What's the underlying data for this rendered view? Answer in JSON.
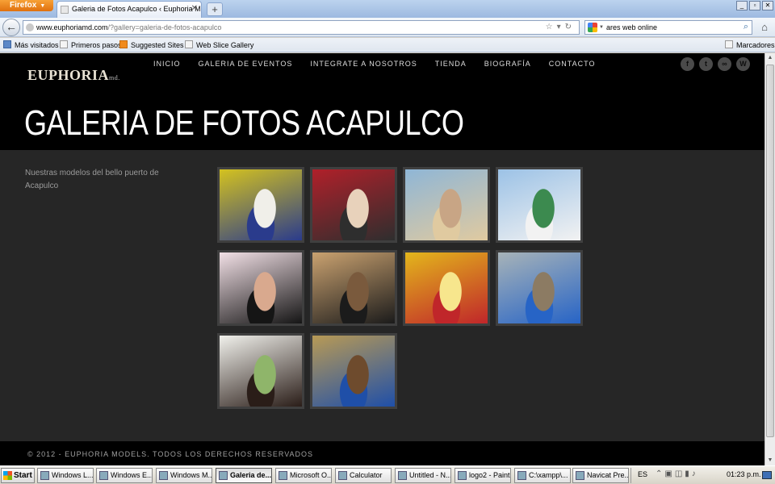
{
  "browser": {
    "app_button": "Firefox",
    "tab_title": "Galeria de Fotos Acapulco ‹ Euphoria Models",
    "new_tab": "+",
    "url_domain": "www.euphoriamd.com",
    "url_path": "/?gallery=galeria-de-fotos-acapulco",
    "search_value": "ares web online"
  },
  "bookmarks": [
    {
      "label": "Más visitados"
    },
    {
      "label": "Primeros pasos"
    },
    {
      "label": "Suggested Sites"
    },
    {
      "label": "Web Slice Gallery"
    },
    {
      "label": "Marcadores"
    }
  ],
  "site": {
    "logo_main": "EUPHORIA",
    "logo_sub": "md.",
    "nav": [
      "INICIO",
      "GALERIA DE EVENTOS",
      "INTEGRATE A NOSOTROS",
      "TIENDA",
      "BIOGRAFÍA",
      "CONTACTO"
    ],
    "social": [
      "f",
      "t",
      "∞",
      "W"
    ],
    "page_title": "GALERIA DE FOTOS ACAPULCO",
    "description": "Nuestras modelos del bello puerto de Acapulco",
    "footer": "© 2012 - EUPHORIA MODELS. TODOS LOS DERECHOS RESERVADOS"
  },
  "gallery": {
    "photos": [
      {
        "name": "photo-two-models-yellow-wall",
        "colors": [
          "#d4c21f",
          "#2a3b8c",
          "#f0efe9"
        ]
      },
      {
        "name": "photo-model-red-jeep",
        "colors": [
          "#b0202a",
          "#2e2e2e",
          "#e8d2bb"
        ]
      },
      {
        "name": "photo-model-beach-rocks",
        "colors": [
          "#8fb6d6",
          "#e0caa0",
          "#c8a585"
        ]
      },
      {
        "name": "photo-model-boat-bikini",
        "colors": [
          "#9cc2e6",
          "#f2f2f2",
          "#3c8a4f"
        ]
      },
      {
        "name": "photo-model-black-dress-stool",
        "colors": [
          "#f2e0e6",
          "#151515",
          "#d9a98e"
        ]
      },
      {
        "name": "photo-model-event-table",
        "colors": [
          "#caa270",
          "#1b1b1b",
          "#7a5a3d"
        ]
      },
      {
        "name": "photo-model-yellow-banner",
        "colors": [
          "#e3b61c",
          "#c0262a",
          "#f7e68d"
        ]
      },
      {
        "name": "photo-model-blue-outfit-street",
        "colors": [
          "#a7b3b8",
          "#2764c6",
          "#8c7b63"
        ]
      },
      {
        "name": "photo-model-white-top-portrait",
        "colors": [
          "#f1f1ec",
          "#2a1d18",
          "#8fb56a"
        ]
      },
      {
        "name": "photo-model-store-shelves",
        "colors": [
          "#b89a55",
          "#1f4fa8",
          "#6e4b2d"
        ]
      }
    ]
  },
  "taskbar": {
    "start": "Start",
    "tasks": [
      "Windows L...",
      "Windows E...",
      "Windows M...",
      "Galeria de...",
      "Microsoft O...",
      "Calculator",
      "Untitled - N...",
      "logo2 - Paint",
      "C:\\xampp\\...",
      "Navicat Pre..."
    ],
    "language": "ES",
    "clock": "01:23 p.m."
  }
}
